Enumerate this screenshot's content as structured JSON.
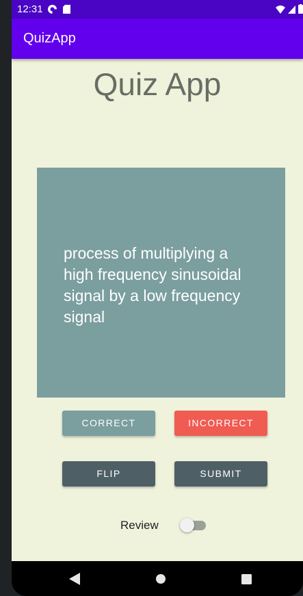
{
  "status_bar": {
    "time": "12:31",
    "icons": [
      "pocket-casts-icon",
      "sd-card-icon",
      "wifi-icon",
      "signal-icon",
      "battery-icon"
    ]
  },
  "app_bar": {
    "title": "QuizApp",
    "color": "#6200ee"
  },
  "main": {
    "heading": "Quiz App",
    "card": {
      "text": "process of multiplying a high frequency sinusoidal signal by a low frequency signal",
      "color": "#7b9e9f"
    },
    "buttons": {
      "correct": "CORRECT",
      "incorrect": "INCORRECT",
      "flip": "FLIP",
      "submit": "SUBMIT"
    },
    "review": {
      "label": "Review",
      "enabled": false
    }
  },
  "colors": {
    "background": "#eff3dc",
    "correct": "#7b9e9f",
    "incorrect": "#f05b52",
    "dark_button": "#4f5f66"
  },
  "nav_bar": {
    "icons": [
      "back-icon",
      "home-icon",
      "recents-icon"
    ]
  }
}
